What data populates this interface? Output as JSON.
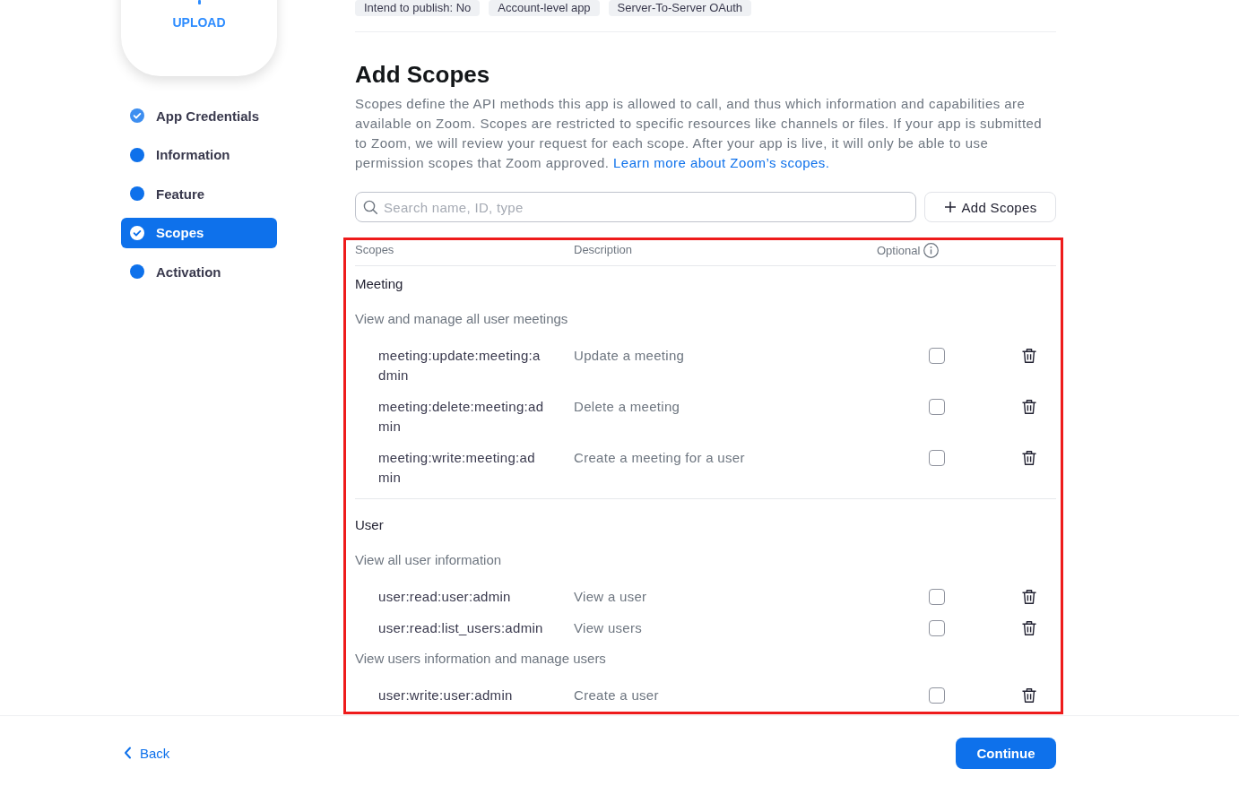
{
  "sidebar": {
    "upload": {
      "label": "UPLOAD"
    },
    "steps": [
      {
        "label": "App Credentials",
        "checked": true,
        "selected": false
      },
      {
        "label": "Information",
        "checked": false,
        "selected": false
      },
      {
        "label": "Feature",
        "checked": false,
        "selected": false
      },
      {
        "label": "Scopes",
        "checked": true,
        "selected": true
      },
      {
        "label": "Activation",
        "checked": false,
        "selected": false
      }
    ]
  },
  "app_tags": [
    "Intend to publish: No",
    "Account-level app",
    "Server-To-Server OAuth"
  ],
  "section": {
    "title": "Add Scopes",
    "description": "Scopes define the API methods this app is allowed to call, and thus which information and capabilities are available on Zoom. Scopes are restricted to specific resources like channels or files. If your app is submitted to Zoom, we will review your request for each scope. After your app is live, it will only be able to use permission scopes that Zoom approved.",
    "link": "Learn more about Zoom’s scopes."
  },
  "search": {
    "placeholder": "Search name, ID, type"
  },
  "add_button": {
    "label": "Add Scopes"
  },
  "table": {
    "highlighted": true,
    "columns": [
      "Scopes",
      "Description",
      "Optional"
    ],
    "groups": [
      {
        "name": "Meeting",
        "subgroups": [
          {
            "name": "View and manage all user meetings",
            "scopes": [
              {
                "scope": "meeting:update:meeting:admin",
                "description": "Update a meeting",
                "optional": false
              },
              {
                "scope": "meeting:delete:meeting:admin",
                "description": "Delete a meeting",
                "optional": false
              },
              {
                "scope": "meeting:write:meeting:admin",
                "description": "Create a meeting for a user",
                "optional": false
              }
            ]
          }
        ]
      },
      {
        "name": "User",
        "subgroups": [
          {
            "name": "View all user information",
            "scopes": [
              {
                "scope": "user:read:user:admin",
                "description": "View a user",
                "optional": false
              },
              {
                "scope": "user:read:list_users:admin",
                "description": "View users",
                "optional": false
              }
            ]
          },
          {
            "name": "View users information and manage users",
            "scopes": [
              {
                "scope": "user:write:user:admin",
                "description": "Create a user",
                "optional": false
              }
            ]
          }
        ]
      }
    ]
  },
  "footer": {
    "back": "Back",
    "continue": "Continue"
  }
}
